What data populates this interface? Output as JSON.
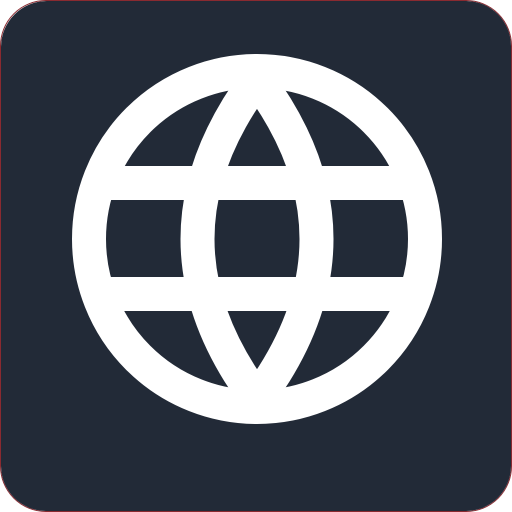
{
  "app_icon": {
    "icon": "globe-icon",
    "colors": {
      "tile_background": "#222a37",
      "tile_border": "#8a2a30",
      "glyph": "#ffffff"
    }
  }
}
